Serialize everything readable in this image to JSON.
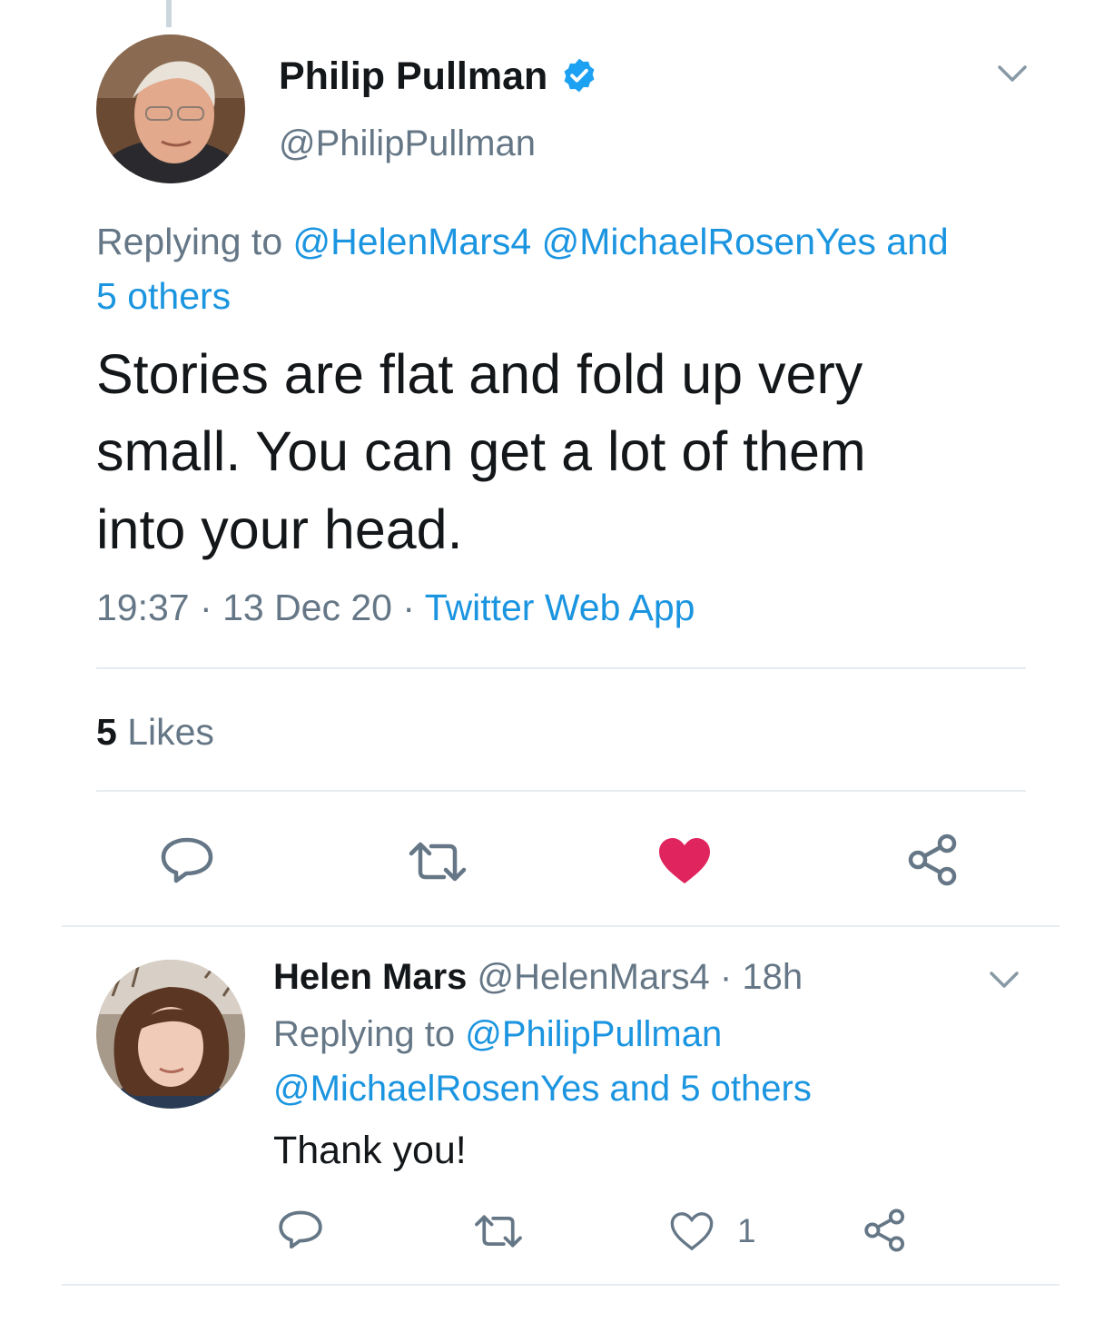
{
  "main_tweet": {
    "author_name": "Philip Pullman",
    "handle": "@PhilipPullman",
    "replying_prefix": "Replying to",
    "replying_users_1": "@HelenMars4 @MichaelRosenYes and",
    "replying_users_2": "5 others",
    "text_line_1": "Stories are flat and fold up very",
    "text_line_2": "small. You can get a lot of them",
    "text_line_3": "into your head.",
    "time": "19:37",
    "sep": "·",
    "date": "13 Dec 20",
    "source": "Twitter Web App",
    "likes_count": "5",
    "likes_label": "Likes",
    "liked": true
  },
  "reply_tweet": {
    "author_name": "Helen Mars",
    "handle_time": "@HelenMars4 · 18h",
    "replying_prefix": "Replying to",
    "replying_user_1": "@PhilipPullman",
    "replying_users_2": "@MichaelRosenYes and 5 others",
    "text": "Thank you!",
    "like_count": "1"
  },
  "colors": {
    "link": "#1b95e0",
    "muted": "#657786",
    "like_active": "#e0245e",
    "verified": "#1da1f2",
    "divider": "#e6ecf0"
  },
  "icons": [
    "verified-badge-icon",
    "chevron-down-icon",
    "reply-icon",
    "retweet-icon",
    "heart-icon",
    "share-icon"
  ]
}
